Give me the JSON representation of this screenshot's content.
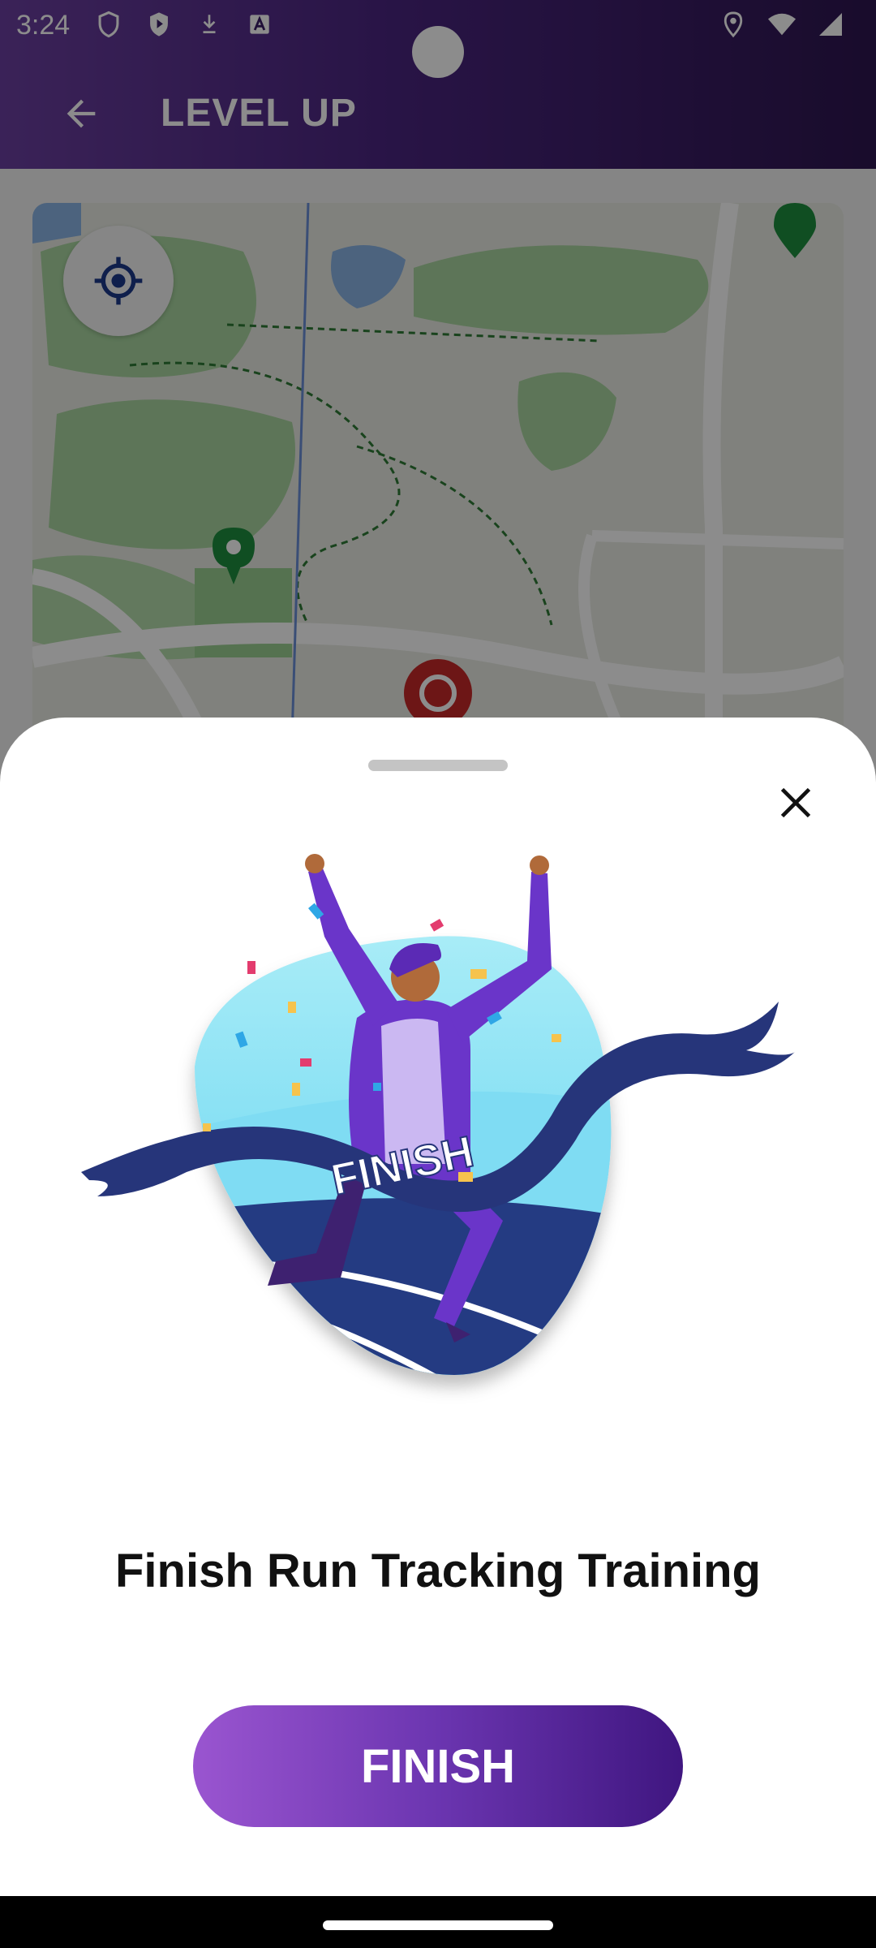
{
  "status_bar": {
    "time": "3:24",
    "icons_left": [
      "shield-icon",
      "play-shield-icon",
      "download-icon",
      "a-icon"
    ],
    "icons_right": [
      "location-icon",
      "wifi-icon",
      "signal-icon",
      "battery-icon"
    ]
  },
  "app_bar": {
    "title": "LEVEL UP",
    "back_icon": "arrow-back-icon"
  },
  "map": {
    "locate_icon": "my-location-icon",
    "markers": [
      "green-pin",
      "green-pin",
      "red-target"
    ]
  },
  "sheet": {
    "title": "Finish Run Tracking Training",
    "button_label": "FINISH",
    "illustration_banner_text": "FINISH",
    "close_icon": "close-icon"
  },
  "colors": {
    "app_bar_start": "#6b3fa0",
    "app_bar_end": "#2e1650",
    "button_start": "#9a55d0",
    "button_end": "#3f1680",
    "ribbon": "#26357a"
  }
}
